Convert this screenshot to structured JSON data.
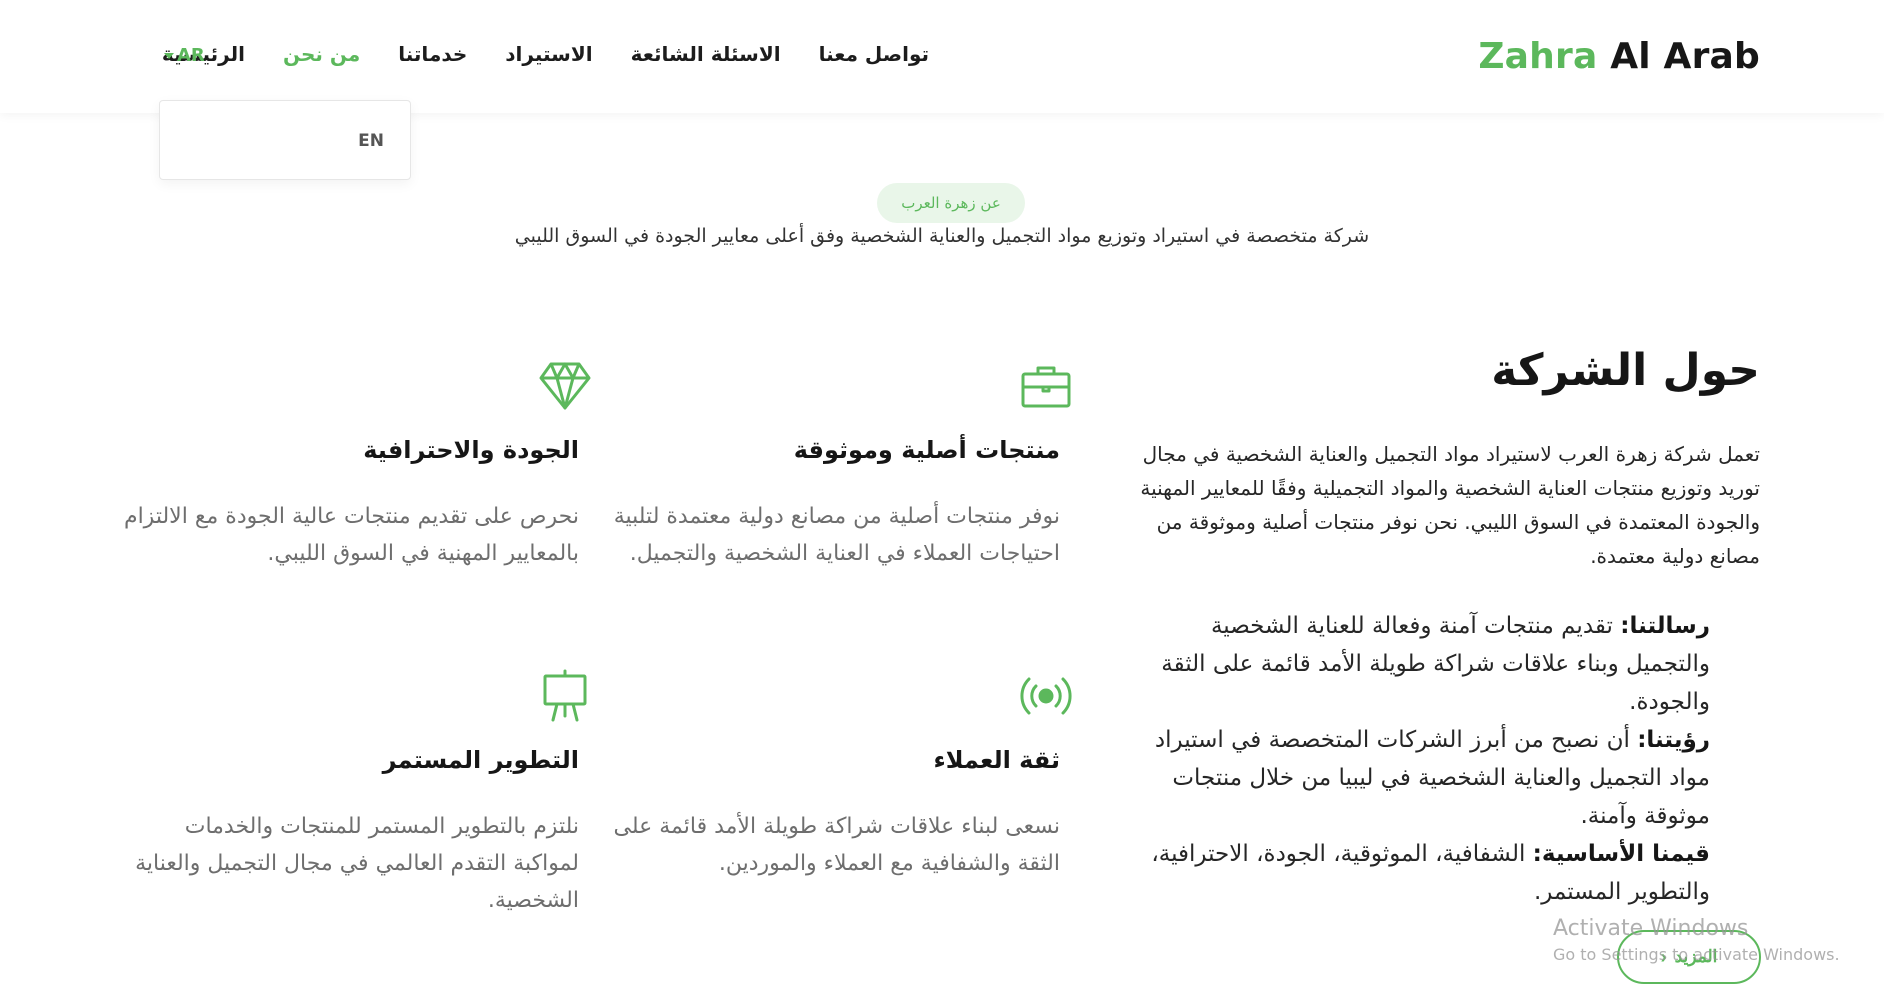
{
  "brand": {
    "part1": "Zahra",
    "part2": "Al Arab"
  },
  "nav": {
    "items": [
      {
        "label": "الرئيسية",
        "active": false
      },
      {
        "label": "من نحن",
        "active": true
      },
      {
        "label": "خدماتنا",
        "active": false
      },
      {
        "label": "الاستيراد",
        "active": false
      },
      {
        "label": "الاسئلة الشائعة",
        "active": false
      },
      {
        "label": "تواصل معنا",
        "active": false
      }
    ],
    "language": {
      "current": "AR",
      "option": "EN"
    }
  },
  "intro": {
    "badge": "عن زهرة العرب",
    "tagline": "شركة متخصصة في استيراد وتوزيع مواد التجميل والعناية الشخصية وفق أعلى معايير الجودة في السوق الليبي"
  },
  "about": {
    "title": "حول الشركة",
    "body": "تعمل شركة زهرة العرب لاستيراد مواد التجميل والعناية الشخصية في مجال توريد وتوزيع منتجات العناية الشخصية والمواد التجميلية وفقًا للمعايير المهنية والجودة المعتمدة في السوق الليبي. نحن نوفر منتجات أصلية وموثوقة من مصانع دولية معتمدة.",
    "mission": {
      "label": "رسالتنا:",
      "text": "تقديم منتجات آمنة وفعالة للعناية الشخصية والتجميل وبناء علاقات شراكة طويلة الأمد قائمة على الثقة والجودة."
    },
    "vision": {
      "label": "رؤيتنا:",
      "text": "أن نصبح من أبرز الشركات المتخصصة في استيراد مواد التجميل والعناية الشخصية في ليبيا من خلال منتجات موثوقة وآمنة."
    },
    "values": {
      "label": "قيمنا الأساسية:",
      "text": "الشفافية، الموثوقية، الجودة، الاحترافية، والتطوير المستمر."
    },
    "more_label": "المزيد"
  },
  "features": [
    {
      "icon": "briefcase-icon",
      "title": "منتجات أصلية وموثوقة",
      "text": "نوفر منتجات أصلية من مصانع دولية معتمدة لتلبية احتياجات العملاء في العناية الشخصية والتجميل."
    },
    {
      "icon": "diamond-icon",
      "title": "الجودة والاحترافية",
      "text": "نحرص على تقديم منتجات عالية الجودة مع الالتزام بالمعايير المهنية في السوق الليبي."
    },
    {
      "icon": "broadcast-icon",
      "title": "ثقة العملاء",
      "text": "نسعى لبناء علاقات شراكة طويلة الأمد قائمة على الثقة والشفافية مع العملاء والموردين."
    },
    {
      "icon": "presentation-board-icon",
      "title": "التطوير المستمر",
      "text": "نلتزم بالتطوير المستمر للمنتجات والخدمات لمواكبة التقدم العالمي في مجال التجميل والعناية الشخصية."
    }
  ],
  "watermark": {
    "line1": "Activate Windows",
    "line2": "Go to Settings to activate Windows."
  },
  "colors": {
    "accent": "#5cb85c",
    "text": "#1f1f1f",
    "muted": "#6e6e6e",
    "badge_bg": "#e9f6e9"
  }
}
